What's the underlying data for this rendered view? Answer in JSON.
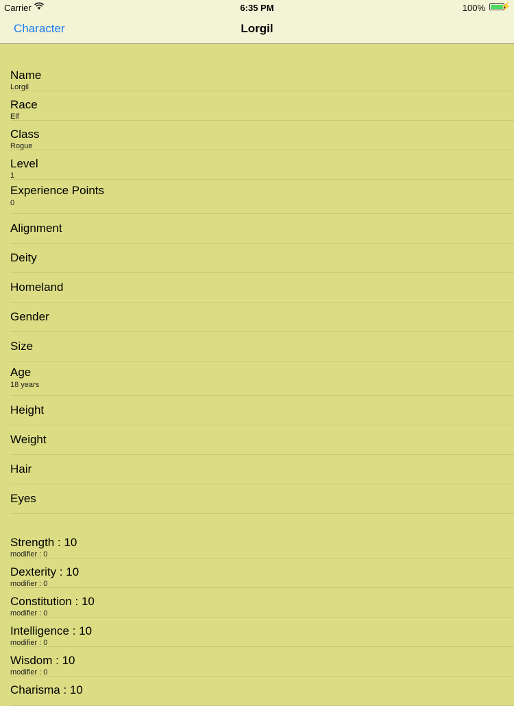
{
  "status_bar": {
    "carrier": "Carrier",
    "time": "6:35 PM",
    "battery": "100%"
  },
  "nav": {
    "back_label": "Character",
    "title": "Lorgil"
  },
  "details": [
    {
      "label": "Name",
      "value": "Lorgil"
    },
    {
      "label": "Race",
      "value": "Elf"
    },
    {
      "label": "Class",
      "value": "Rogue"
    },
    {
      "label": "Level",
      "value": "1"
    },
    {
      "label": "Experience Points",
      "value": "0"
    },
    {
      "label": "Alignment",
      "value": ""
    },
    {
      "label": "Deity",
      "value": ""
    },
    {
      "label": "Homeland",
      "value": ""
    },
    {
      "label": "Gender",
      "value": ""
    },
    {
      "label": "Size",
      "value": ""
    },
    {
      "label": "Age",
      "value": "18 years"
    },
    {
      "label": "Height",
      "value": ""
    },
    {
      "label": "Weight",
      "value": ""
    },
    {
      "label": "Hair",
      "value": ""
    },
    {
      "label": "Eyes",
      "value": ""
    }
  ],
  "abilities": [
    {
      "name": "Strength",
      "score": "10",
      "modifier": "modifier : 0"
    },
    {
      "name": "Dexterity",
      "score": "10",
      "modifier": "modifier : 0"
    },
    {
      "name": "Constitution",
      "score": "10",
      "modifier": "modifier : 0"
    },
    {
      "name": "Intelligence",
      "score": "10",
      "modifier": "modifier : 0"
    },
    {
      "name": "Wisdom",
      "score": "10",
      "modifier": "modifier : 0"
    },
    {
      "name": "Charisma",
      "score": "10",
      "modifier": ""
    }
  ],
  "colors": {
    "background": "#dcdc84",
    "bar": "#f3f3d6",
    "accent": "#1a7cf5"
  }
}
